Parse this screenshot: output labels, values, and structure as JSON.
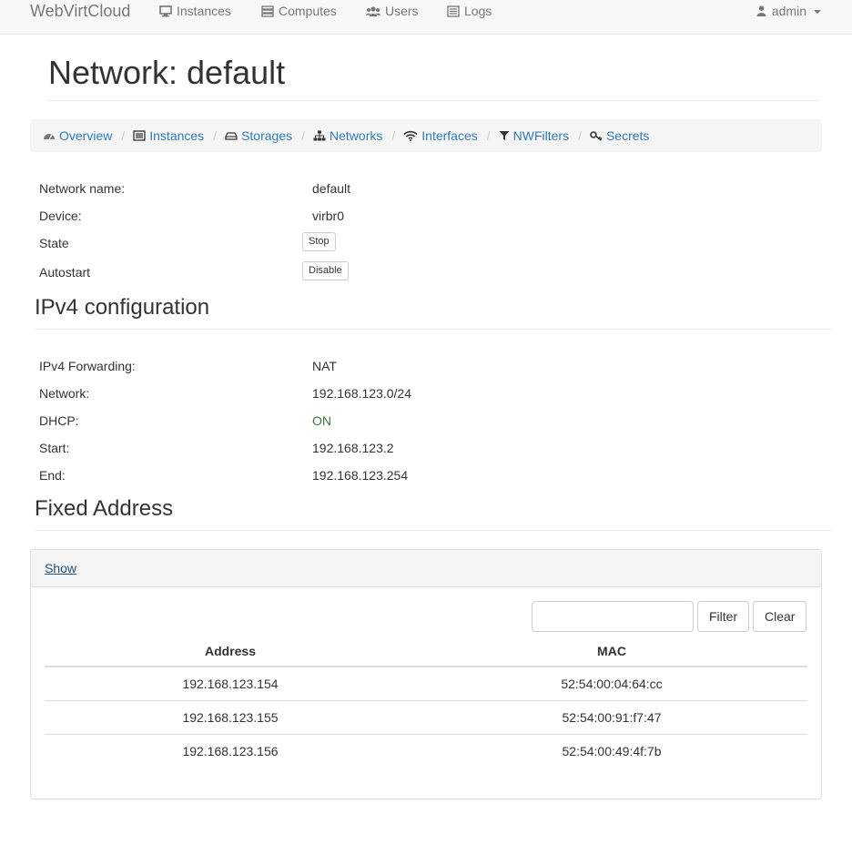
{
  "navbar": {
    "brand": "WebVirtCloud",
    "items": [
      {
        "label": "Instances",
        "icon": "desktop-icon"
      },
      {
        "label": "Computes",
        "icon": "server-icon"
      },
      {
        "label": "Users",
        "icon": "users-icon"
      },
      {
        "label": "Logs",
        "icon": "list-icon"
      }
    ],
    "user": {
      "label": "admin",
      "icon": "user-icon"
    }
  },
  "page": {
    "title": "Network: default"
  },
  "breadcrumb": [
    {
      "label": "Overview",
      "icon": "dashboard-icon"
    },
    {
      "label": "Instances",
      "icon": "list-icon"
    },
    {
      "label": "Storages",
      "icon": "hdd-icon"
    },
    {
      "label": "Networks",
      "icon": "sitemap-icon"
    },
    {
      "label": "Interfaces",
      "icon": "wifi-icon"
    },
    {
      "label": "NWFilters",
      "icon": "filter-icon"
    },
    {
      "label": "Secrets",
      "icon": "key-icon"
    }
  ],
  "separator": "/",
  "info": {
    "network_name_label": "Network name:",
    "network_name": "default",
    "device_label": "Device:",
    "device": "virbr0",
    "state_label": "State",
    "state_button": "Stop",
    "autostart_label": "Autostart",
    "autostart_button": "Disable"
  },
  "ipv4": {
    "title": "IPv4 configuration",
    "forwarding_label": "IPv4 Forwarding:",
    "forwarding": "NAT",
    "network_label": "Network:",
    "network": "192.168.123.0/24",
    "dhcp_label": "DHCP:",
    "dhcp": "ON",
    "start_label": "Start:",
    "start": "192.168.123.2",
    "end_label": "End:",
    "end": "192.168.123.254"
  },
  "fixed": {
    "title": "Fixed Address",
    "show_link": "Show",
    "filter_value": "",
    "filter_button": "Filter",
    "clear_button": "Clear",
    "columns": [
      "Address",
      "MAC"
    ],
    "rows": [
      {
        "address": "192.168.123.154",
        "mac": "52:54:00:04:64:cc"
      },
      {
        "address": "192.168.123.155",
        "mac": "52:54:00:91:f7:47"
      },
      {
        "address": "192.168.123.156",
        "mac": "52:54:00:49:4f:7b"
      }
    ]
  },
  "colors": {
    "link": "#337ab7",
    "dhcp_on": "#3c763d",
    "navbar_text": "#777777"
  }
}
